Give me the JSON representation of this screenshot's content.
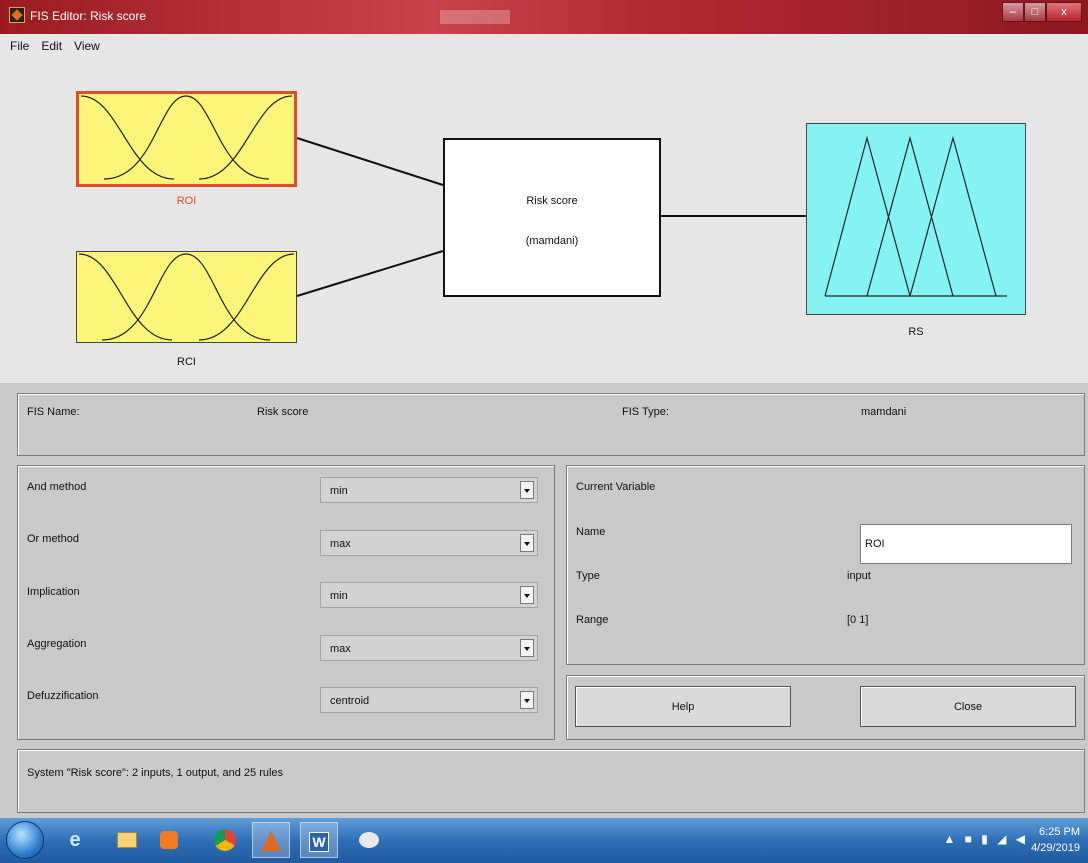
{
  "window": {
    "title": "FIS Editor: Risk score",
    "minimize": "–",
    "maximize": "□",
    "close": "x"
  },
  "menu": [
    "File",
    "Edit",
    "View"
  ],
  "diagram": {
    "input1_label": "ROI",
    "input2_label": "RCI",
    "system_name": "Risk score",
    "system_type": "(mamdani)",
    "output_label": "RS"
  },
  "fis_info": {
    "name_label": "FIS Name:",
    "name_value": "Risk score",
    "type_label": "FIS Type:",
    "type_value": "mamdani"
  },
  "methods": [
    {
      "label": "And method",
      "value": "min"
    },
    {
      "label": "Or method",
      "value": "max"
    },
    {
      "label": "Implication",
      "value": "min"
    },
    {
      "label": "Aggregation",
      "value": "max"
    },
    {
      "label": "Defuzzification",
      "value": "centroid"
    }
  ],
  "current_variable": {
    "heading": "Current Variable",
    "name_label": "Name",
    "name_value": "ROI",
    "type_label": "Type",
    "type_value": "input",
    "range_label": "Range",
    "range_value": "[0 1]"
  },
  "buttons": {
    "help": "Help",
    "close": "Close"
  },
  "status": "System \"Risk score\": 2 inputs, 1 output, and 25 rules",
  "taskbar": {
    "time": "6:25 PM",
    "date": "4/29/2019"
  },
  "colors": {
    "input_box": "#fcf57a",
    "output_box": "#86f3f3",
    "selected_border": "#e24a2a",
    "titlebar": "#b02a33"
  }
}
